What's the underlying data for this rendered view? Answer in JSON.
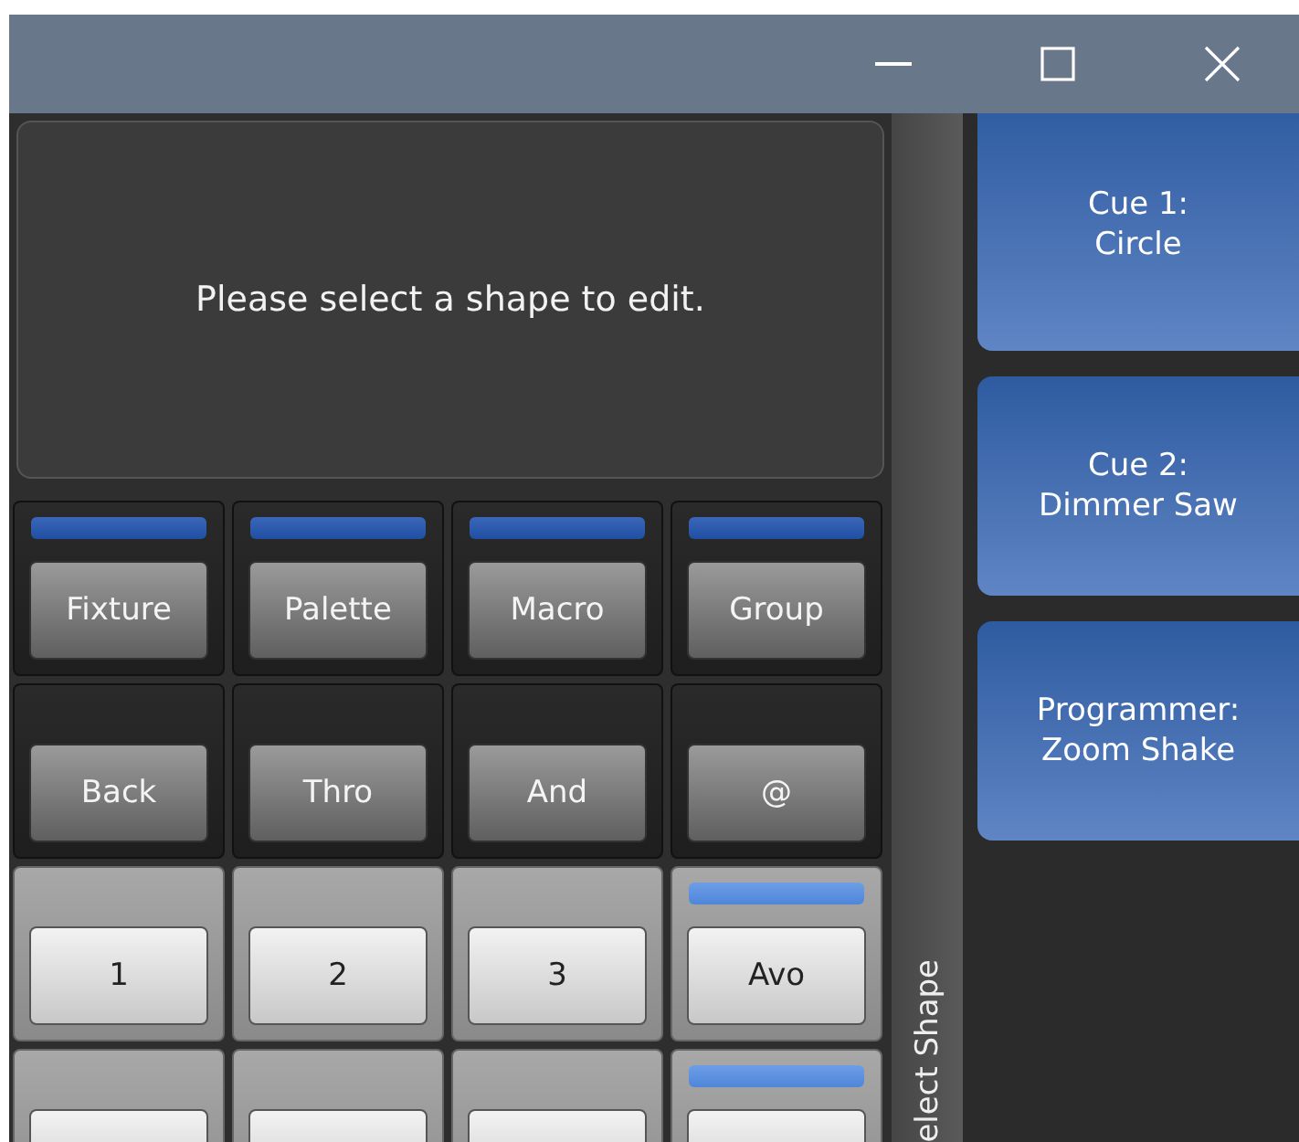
{
  "window": {
    "controls": [
      {
        "kind": "minimize"
      },
      {
        "kind": "maximize"
      },
      {
        "kind": "close"
      }
    ]
  },
  "message": "Please select a shape to edit.",
  "key_rows": [
    {
      "kind": "dark",
      "keys": [
        {
          "label": "Fixture",
          "indicator": true
        },
        {
          "label": "Palette",
          "indicator": true
        },
        {
          "label": "Macro",
          "indicator": true
        },
        {
          "label": "Group",
          "indicator": true
        }
      ]
    },
    {
      "kind": "dark",
      "keys": [
        {
          "label": "Back",
          "indicator": false
        },
        {
          "label": "Thro",
          "indicator": false
        },
        {
          "label": "And",
          "indicator": false
        },
        {
          "label": "@",
          "indicator": false
        }
      ]
    },
    {
      "kind": "light",
      "keys": [
        {
          "label": "1",
          "indicator": false
        },
        {
          "label": "2",
          "indicator": false
        },
        {
          "label": "3",
          "indicator": false
        },
        {
          "label": "Avo",
          "indicator": true
        }
      ]
    },
    {
      "kind": "light",
      "keys": [
        {
          "indicator": false
        },
        {
          "indicator": false
        },
        {
          "indicator": false
        },
        {
          "indicator": true
        }
      ]
    }
  ],
  "side_tab": "elect Shape",
  "playbacks": [
    {
      "title": "Cue 1:",
      "name": "Circle"
    },
    {
      "title": "Cue 2:",
      "name": "Dimmer Saw"
    },
    {
      "title": "Programmer:",
      "name": "Zoom Shake"
    }
  ]
}
